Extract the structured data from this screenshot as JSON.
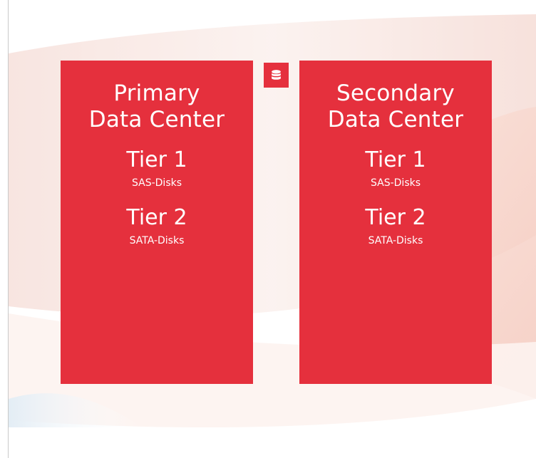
{
  "colors": {
    "panel": "#e5303d",
    "text": "#ffffff"
  },
  "icons": {
    "badge": "database-icon"
  },
  "panels": [
    {
      "title_line1": "Primary",
      "title_line2": "Data Center",
      "tiers": [
        {
          "name": "Tier 1",
          "disks": "SAS-Disks"
        },
        {
          "name": "Tier 2",
          "disks": "SATA-Disks"
        }
      ]
    },
    {
      "title_line1": "Secondary",
      "title_line2": "Data Center",
      "tiers": [
        {
          "name": "Tier 1",
          "disks": "SAS-Disks"
        },
        {
          "name": "Tier 2",
          "disks": "SATA-Disks"
        }
      ]
    }
  ]
}
